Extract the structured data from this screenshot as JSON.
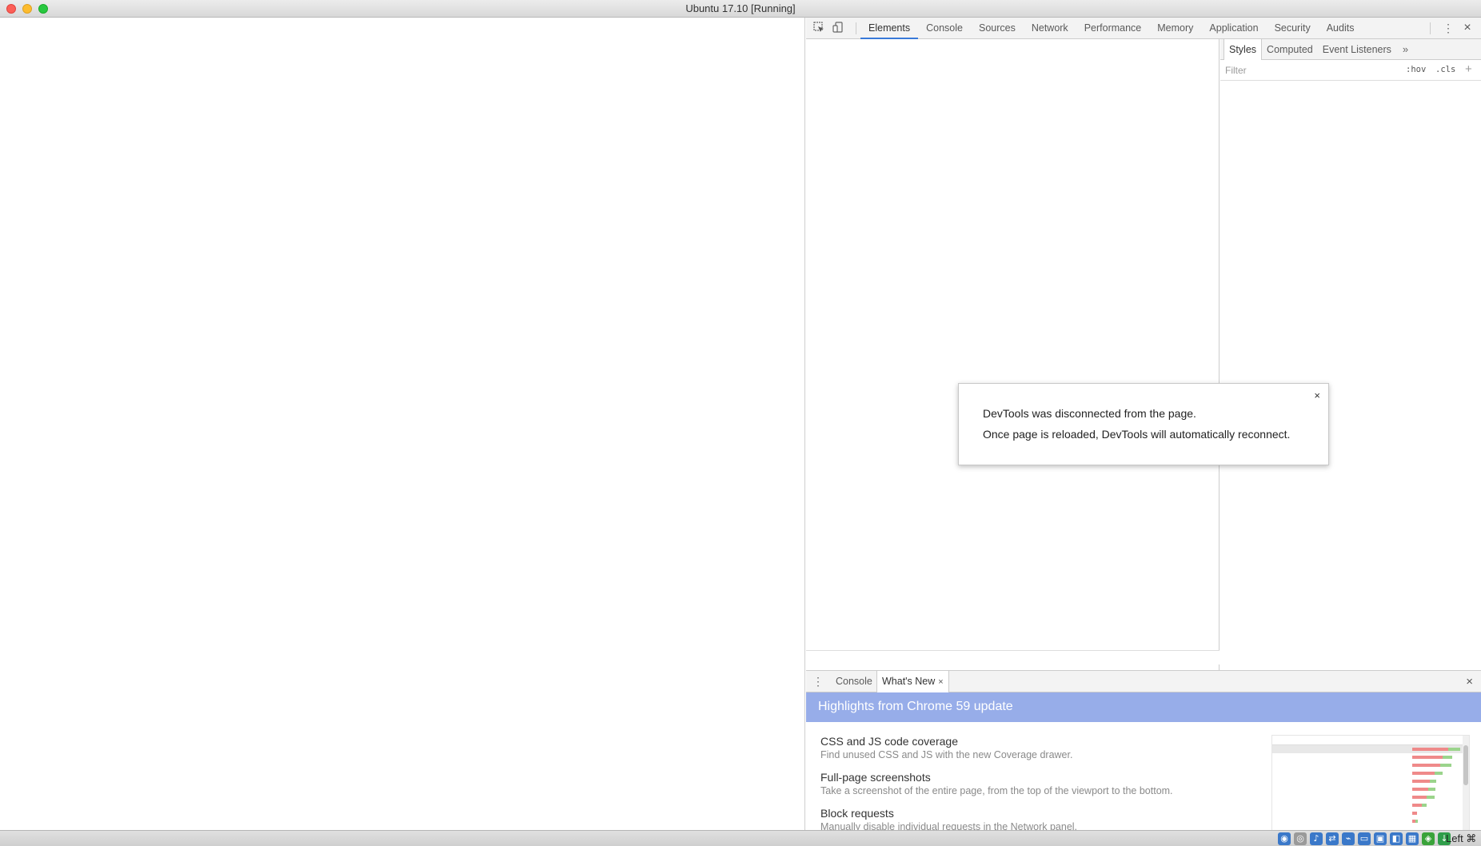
{
  "window": {
    "title": "Ubuntu 17.10 [Running]"
  },
  "devtools": {
    "tabs": [
      "Elements",
      "Console",
      "Sources",
      "Network",
      "Performance",
      "Memory",
      "Application",
      "Security",
      "Audits"
    ],
    "active_tab": "Elements",
    "styles_tabs": [
      "Styles",
      "Computed",
      "Event Listeners"
    ],
    "styles_more": "»",
    "filter": {
      "placeholder": "Filter"
    },
    "hov_label": ":hov",
    "cls_label": ".cls",
    "plus_label": "+"
  },
  "dialog": {
    "close_label": "×",
    "line1": "DevTools was disconnected from the page.",
    "line2": "Once page is reloaded, DevTools will automatically reconnect."
  },
  "drawer": {
    "tabs": {
      "console": "Console",
      "whats_new": "What's New"
    },
    "tab_close": "×",
    "close_label": "×",
    "highlights": "Highlights from Chrome 59 update",
    "items": [
      {
        "title": "CSS and JS code coverage",
        "desc": "Find unused CSS and JS with the new Coverage drawer."
      },
      {
        "title": "Full-page screenshots",
        "desc": "Take a screenshot of the entire page, from the top of the viewport to the bottom."
      },
      {
        "title": "Block requests",
        "desc": "Manually disable individual requests in the Network panel."
      }
    ]
  },
  "statusbar": {
    "host_key": "Left ⌘"
  }
}
